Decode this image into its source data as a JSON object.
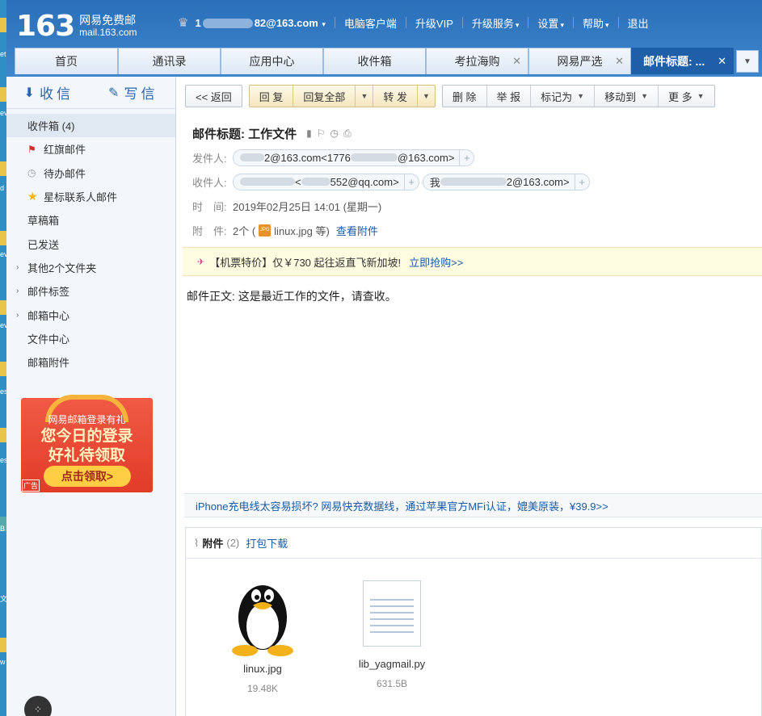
{
  "header": {
    "logo_number": "163",
    "logo_title": "网易免费邮",
    "logo_domain": "mail.163.com",
    "account_prefix": "1",
    "account_suffix": "82@163.com",
    "links": [
      "电脑客户端",
      "升级VIP",
      "升级服务",
      "设置",
      "帮助",
      "退出"
    ]
  },
  "tabs": [
    {
      "label": "首页",
      "closable": false,
      "active": false
    },
    {
      "label": "通讯录",
      "closable": false,
      "active": false
    },
    {
      "label": "应用中心",
      "closable": false,
      "active": false
    },
    {
      "label": "收件箱",
      "closable": false,
      "active": false
    },
    {
      "label": "考拉海购",
      "closable": true,
      "active": false
    },
    {
      "label": "网易严选",
      "closable": true,
      "active": false
    },
    {
      "label": "邮件标题: ...",
      "closable": true,
      "active": true
    }
  ],
  "sidebar": {
    "receive_label": "收信",
    "write_label": "写信",
    "folders": [
      {
        "label": "收件箱 (4)",
        "icon": "none"
      },
      {
        "label": "红旗邮件",
        "icon": "red-flag-icon"
      },
      {
        "label": "待办邮件",
        "icon": "clock-icon"
      },
      {
        "label": "星标联系人邮件",
        "icon": "star-icon"
      },
      {
        "label": "草稿箱",
        "icon": "none"
      },
      {
        "label": "已发送",
        "icon": "none"
      },
      {
        "label": "其他2个文件夹",
        "icon": "arrow"
      },
      {
        "label": "邮件标签",
        "icon": "arrow"
      },
      {
        "label": "邮箱中心",
        "icon": "arrow"
      },
      {
        "label": "文件中心",
        "icon": "none"
      },
      {
        "label": "邮箱附件",
        "icon": "none"
      }
    ],
    "ad": {
      "top": "网易邮箱登录有礼",
      "line1": "您今日的登录",
      "line2": "好礼待领取",
      "button": "点击领取>",
      "tag": "广告"
    }
  },
  "toolbar": {
    "back": "<< 返回",
    "reply": "回 复",
    "reply_all": "回复全部",
    "forward": "转 发",
    "delete": "删 除",
    "report": "举 报",
    "mark_as": "标记为",
    "move_to": "移动到",
    "more": "更 多"
  },
  "mail": {
    "subject": "邮件标题: 工作文件",
    "from_label": "发件人:",
    "from_a": "2@163.com<1776",
    "from_b": "@163.com>",
    "to_label": "收件人:",
    "to_1": "552@qq.com>",
    "to_1_pre": "<",
    "to_2_pre": "我",
    "to_2": "2@163.com>",
    "time_label": "时　间:",
    "time": "2019年02月25日 14:01 (星期一)",
    "attach_label": "附　件:",
    "attach_count": "2个 (",
    "attach_name": "linux.jpg 等)",
    "attach_view": "查看附件",
    "body": "邮件正文: 这是最近工作的文件，请查收。"
  },
  "promo_top": {
    "text": "【机票特价】仅￥730 起往返直飞新加坡!",
    "link": "立即抢购>>"
  },
  "promo_bottom": "iPhone充电线太容易损坏? 网易快充数据线，通过苹果官方MFi认证，媲美原装，¥39.9>>",
  "attachments": {
    "title": "附件",
    "count": "(2)",
    "download_all": "打包下载",
    "files": [
      {
        "name": "linux.jpg",
        "size": "19.48K"
      },
      {
        "name": "lib_yagmail.py",
        "size": "631.5B"
      }
    ]
  },
  "colors": {
    "header_blue": "#2a6fb9",
    "active_tab": "#1f5fa8",
    "link": "#1a5aa6"
  }
}
